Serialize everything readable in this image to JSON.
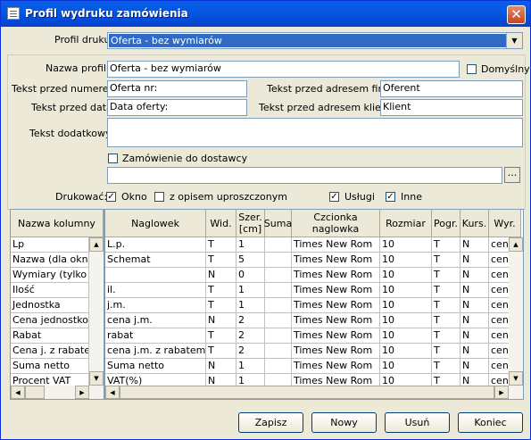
{
  "window": {
    "title": "Profil wydruku zamówienia"
  },
  "profil_druku": {
    "label": "Profil druku",
    "value": "Oferta - bez wymiarów"
  },
  "form": {
    "nazwa_profilu_label": "Nazwa profilu",
    "nazwa_profilu_value": "Oferta - bez wymiarów",
    "domyslny_label": "Domyślny",
    "tekst_przed_numerem_label": "Tekst przed numerem",
    "tekst_przed_numerem_value": "Oferta nr:",
    "tekst_przed_adresem_firmy_label": "Tekst przed adresem firmy",
    "tekst_przed_adresem_firmy_value": "Oferent",
    "tekst_przed_data_label": "Tekst przed datą",
    "tekst_przed_data_value": "Data oferty:",
    "tekst_przed_adresem_klienta_label": "Tekst przed adresem klienta",
    "tekst_przed_adresem_klienta_value": "Klient",
    "tekst_dodatkowy_label": "Tekst dodatkowy",
    "tekst_dodatkowy_value": "",
    "zamowienie_label": "Zamówienie do dostawcy",
    "zamowienie_value": "",
    "ellipsis": "..."
  },
  "drukowac": {
    "label": "Drukować:",
    "okno": "Okno",
    "okno_checked": "✓",
    "opis": "z opisem uproszczonym",
    "opis_checked": "",
    "uslugi": "Usługi",
    "uslugi_checked": "✓",
    "inne": "Inne",
    "inne_checked": "✓"
  },
  "left_grid": {
    "header": "Nazwa kolumny",
    "rows": [
      "Lp",
      "Nazwa (dla okna",
      "Wymiary (tylko dla",
      "Ilość",
      "Jednostka",
      "Cena jednostkow",
      "Rabat",
      "Cena j. z rabatem",
      "Suma netto",
      "Procent VAT"
    ]
  },
  "right_grid": {
    "headers": [
      "Naglowek",
      "Wid.",
      "Szer. [cm]",
      "Suma",
      "Czcionka naglowka",
      "Rozmiar",
      "Pogr.",
      "Kurs.",
      "Wyr."
    ],
    "rows": [
      [
        "L.p.",
        "T",
        "1",
        "",
        "Times New Rom",
        "10",
        "T",
        "N",
        "cen"
      ],
      [
        "Schemat",
        "T",
        "5",
        "",
        "Times New Rom",
        "10",
        "T",
        "N",
        "cen"
      ],
      [
        "",
        "N",
        "0",
        "",
        "Times New Rom",
        "10",
        "T",
        "N",
        "cen"
      ],
      [
        "il.",
        "T",
        "1",
        "",
        "Times New Rom",
        "10",
        "T",
        "N",
        "cen"
      ],
      [
        "j.m.",
        "T",
        "1",
        "",
        "Times New Rom",
        "10",
        "T",
        "N",
        "cen"
      ],
      [
        "cena j.m.",
        "N",
        "2",
        "",
        "Times New Rom",
        "10",
        "T",
        "N",
        "cen"
      ],
      [
        "rabat",
        "T",
        "2",
        "",
        "Times New Rom",
        "10",
        "T",
        "N",
        "cen"
      ],
      [
        "cena j.m. z rabatem",
        "T",
        "2",
        "",
        "Times New Rom",
        "10",
        "T",
        "N",
        "cen"
      ],
      [
        "Suma netto",
        "N",
        "1",
        "",
        "Times New Rom",
        "10",
        "T",
        "N",
        "cen"
      ],
      [
        "VAT(%)",
        "N",
        "1",
        "",
        "Times New Rom",
        "10",
        "T",
        "N",
        "cen"
      ]
    ]
  },
  "buttons": {
    "zapisz": "Zapisz",
    "nowy": "Nowy",
    "usun": "Usuń",
    "koniec": "Koniec"
  }
}
